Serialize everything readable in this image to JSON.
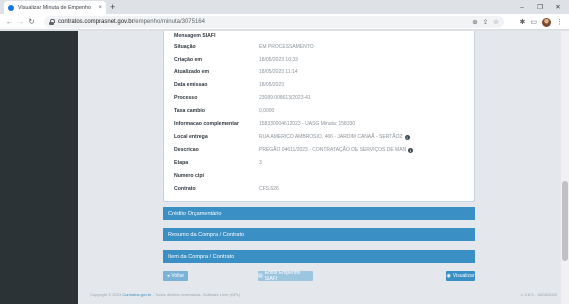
{
  "browser": {
    "tab_title": "Visualizar Minuta de Empenho",
    "tab_close": "×",
    "new_tab": "+",
    "url_host": "contratos.comprasnet.gov.br",
    "url_path": "/empenho/minuta/3075164",
    "win_minimize": "–",
    "win_restore": "❐",
    "win_close": "✕",
    "back": "←",
    "forward": "→",
    "reload": "↻"
  },
  "details": [
    {
      "label": "Mensagem SIAFI",
      "value": ""
    },
    {
      "label": "Situação",
      "value": "EM PROCESSAMENTO"
    },
    {
      "label": "Criação em",
      "value": "18/05/2023 10:33"
    },
    {
      "label": "Atualizado em",
      "value": "18/05/2023 11:14"
    },
    {
      "label": "Data emissao",
      "value": "18/05/2023"
    },
    {
      "label": "Processo",
      "value": "23089.008613/2023-41"
    },
    {
      "label": "Taxa cambio",
      "value": "0,0000"
    },
    {
      "label": "Informacao complementar",
      "value": "158330004612023 - UASG Minuta: 158330"
    },
    {
      "label": "Local entrega",
      "value": "RUA AMERICO AMBROSIO, 466 - JARDIM CANAÃ - SERTÃOZ"
    },
    {
      "label": "Descricao",
      "value": "PREGÃO 04611/2023 - CONTRATAÇÃO DE SERVIÇOS DE MAN"
    },
    {
      "label": "Etapa",
      "value": "3"
    },
    {
      "label": "Numero cipi",
      "value": ""
    },
    {
      "label": "Contrato",
      "value": "CFS.626"
    }
  ],
  "sections": [
    {
      "label": "Crédito Orçamentário"
    },
    {
      "label": "Resumo da Compra / Contrato"
    },
    {
      "label": "Item da Compra / Contrato"
    }
  ],
  "buttons": {
    "back": "Voltar",
    "create": "Emitir Empenho SIAFI",
    "print": "Visualizar"
  },
  "footer": {
    "left_prefix": "Copyright © 2023",
    "left_link": "Contratos.gov.br",
    "left_suffix": "- Todos direitos reservados. Software Livre (GPL).",
    "right": "v. 5.8.9 - 18/05/2023"
  },
  "colors": {
    "section_blue": "#3a8fc4",
    "sidebar": "#2b3336",
    "page_bg": "#e4e8ec"
  }
}
